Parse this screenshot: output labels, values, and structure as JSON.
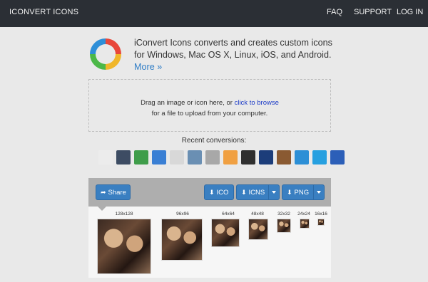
{
  "header": {
    "brand": "ICONVERT ICONS",
    "nav": [
      "FAQ",
      "SUPPORT",
      "LOG IN"
    ]
  },
  "intro": {
    "text": "iConvert Icons converts and creates custom icons for Windows, Mac OS X, Linux, iOS, and Android.",
    "more_link": "More »"
  },
  "dropzone": {
    "text_before": "Drag an image or icon here, or",
    "browse_link": "click to browse",
    "text_after": "for a file to upload from your computer."
  },
  "recent": {
    "label": "Recent conversions:",
    "icons": [
      {
        "name": "figure-icon",
        "color": "#ececec"
      },
      {
        "name": "photo-icon",
        "color": "#3d4c63"
      },
      {
        "name": "money-icon",
        "color": "#3f9d4a"
      },
      {
        "name": "calendar-icon",
        "color": "#3a7fd4"
      },
      {
        "name": "paint-icon",
        "color": "#d8d8d8"
      },
      {
        "name": "document-icon",
        "color": "#6a8fb3"
      },
      {
        "name": "video-icon",
        "color": "#a8a8a8"
      },
      {
        "name": "stick-icon",
        "color": "#f0a042"
      },
      {
        "name": "device-icon",
        "color": "#2f2f2f"
      },
      {
        "name": "laptop-icon",
        "color": "#1c3d7a"
      },
      {
        "name": "book-icon",
        "color": "#8a5a32"
      },
      {
        "name": "tools-icon",
        "color": "#2c8fd6"
      },
      {
        "name": "store-icon",
        "color": "#26a0e0"
      },
      {
        "name": "helmet-icon",
        "color": "#2c5fb8"
      }
    ]
  },
  "toolbar": {
    "share_label": "Share",
    "ico_label": "ICO",
    "icns_label": "ICNS",
    "png_label": "PNG"
  },
  "preview": {
    "sizes": [
      "128x128",
      "96x96",
      "64x64",
      "48x48",
      "32x32",
      "24x24",
      "16x16"
    ]
  },
  "colors": {
    "topbar": "#2b2f35",
    "accent_button": "#3a7fc1",
    "link": "#2f7dc6"
  }
}
